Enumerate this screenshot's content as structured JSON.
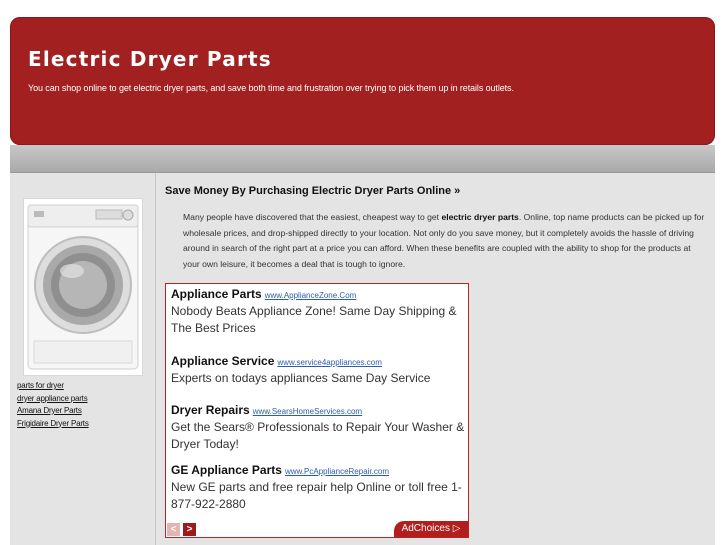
{
  "header": {
    "title": "Electric Dryer Parts",
    "description": "You can shop online to get electric dryer parts, and save both time and frustration over trying to pick them up in retails outlets."
  },
  "sidebar": {
    "image_alt": "front-load dryer product image",
    "links": [
      "parts for dryer",
      "dryer appliance parts",
      "Amana Dryer Parts",
      "Frigidaire Dryer Parts"
    ]
  },
  "post": {
    "title": "Save Money By Purchasing Electric Dryer Parts Online »",
    "body_before": "Many people have discovered that the easiest, cheapest way to get ",
    "body_bold": "electric dryer parts",
    "body_after": ". Online, top name products can be picked up for wholesale prices, and drop-shipped directly to your location. Not only do you save money, but it completely avoids the hassle of driving around in search of the right part at a price you can afford. When these benefits are coupled with the ability to shop for the products at your own leisure, it becomes a deal that is tough to ignore."
  },
  "ads": [
    {
      "title": "Appliance Parts",
      "url": "www.ApplianceZone.Com",
      "text": "Nobody Beats Appliance Zone! Same Day Shipping & The Best Prices"
    },
    {
      "title": "Appliance Service",
      "url": "www.service4appliances.com",
      "text": "Experts on todays appliances Same Day Service"
    },
    {
      "title": "Dryer Repairs",
      "url": "www.SearsHomeServices.com",
      "text": "Get the Sears® Professionals to Repair Your Washer & Dryer Today!"
    },
    {
      "title": "GE Appliance Parts",
      "url": "www.PcApplianceRepair.com",
      "text": "New GE parts and free repair help Online or toll free 1-877-922-2880"
    }
  ],
  "ad_nav": {
    "prev": "<",
    "next": ">"
  },
  "adchoices": "AdChoices ▷"
}
